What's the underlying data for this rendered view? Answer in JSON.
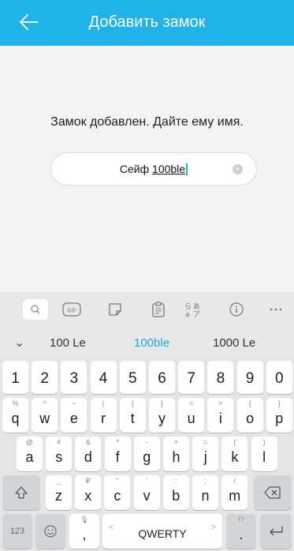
{
  "header": {
    "title": "Добавить замок"
  },
  "message": "Замок добавлен. Дайте ему имя.",
  "name_field": {
    "prefix": "Сейф ",
    "composing": "100ble"
  },
  "keyboard": {
    "toolbar": [
      "search-icon",
      "gif-icon",
      "sticker-icon",
      "clipboard-icon",
      "language-icon",
      "info-icon",
      "more-icon"
    ],
    "gif_label": "GIF",
    "suggestions": [
      "100 Le",
      "100ble",
      "1000 Le"
    ],
    "number_row": [
      "1",
      "2",
      "3",
      "4",
      "5",
      "6",
      "7",
      "8",
      "9",
      "0"
    ],
    "row1": [
      {
        "k": "q",
        "h": "%"
      },
      {
        "k": "w",
        "h": "^"
      },
      {
        "k": "e",
        "h": "~"
      },
      {
        "k": "r",
        "h": "|"
      },
      {
        "k": "t",
        "h": "["
      },
      {
        "k": "y",
        "h": "]"
      },
      {
        "k": "u",
        "h": "<"
      },
      {
        "k": "i",
        "h": ">"
      },
      {
        "k": "o",
        "h": "{"
      },
      {
        "k": "p",
        "h": "}"
      }
    ],
    "row2": [
      {
        "k": "a",
        "h": "@"
      },
      {
        "k": "s",
        "h": "#"
      },
      {
        "k": "d",
        "h": "&"
      },
      {
        "k": "f",
        "h": "*"
      },
      {
        "k": "g",
        "h": "-"
      },
      {
        "k": "h",
        "h": "+"
      },
      {
        "k": "j",
        "h": "="
      },
      {
        "k": "k",
        "h": "("
      },
      {
        "k": "l",
        "h": ")"
      }
    ],
    "row3": [
      {
        "k": "z",
        "h": "_"
      },
      {
        "k": "x",
        "h": "₽"
      },
      {
        "k": "c",
        "h": "\""
      },
      {
        "k": "v",
        "h": "'"
      },
      {
        "k": "b",
        "h": ":"
      },
      {
        "k": "n",
        "h": ";"
      },
      {
        "k": "m",
        "h": "/"
      }
    ],
    "symbols_key": "123",
    "comma_key": ",",
    "space_label": "QWERTY",
    "space_left": "<",
    "space_right": ">",
    "period_key": ".",
    "period_hint": "!?"
  }
}
